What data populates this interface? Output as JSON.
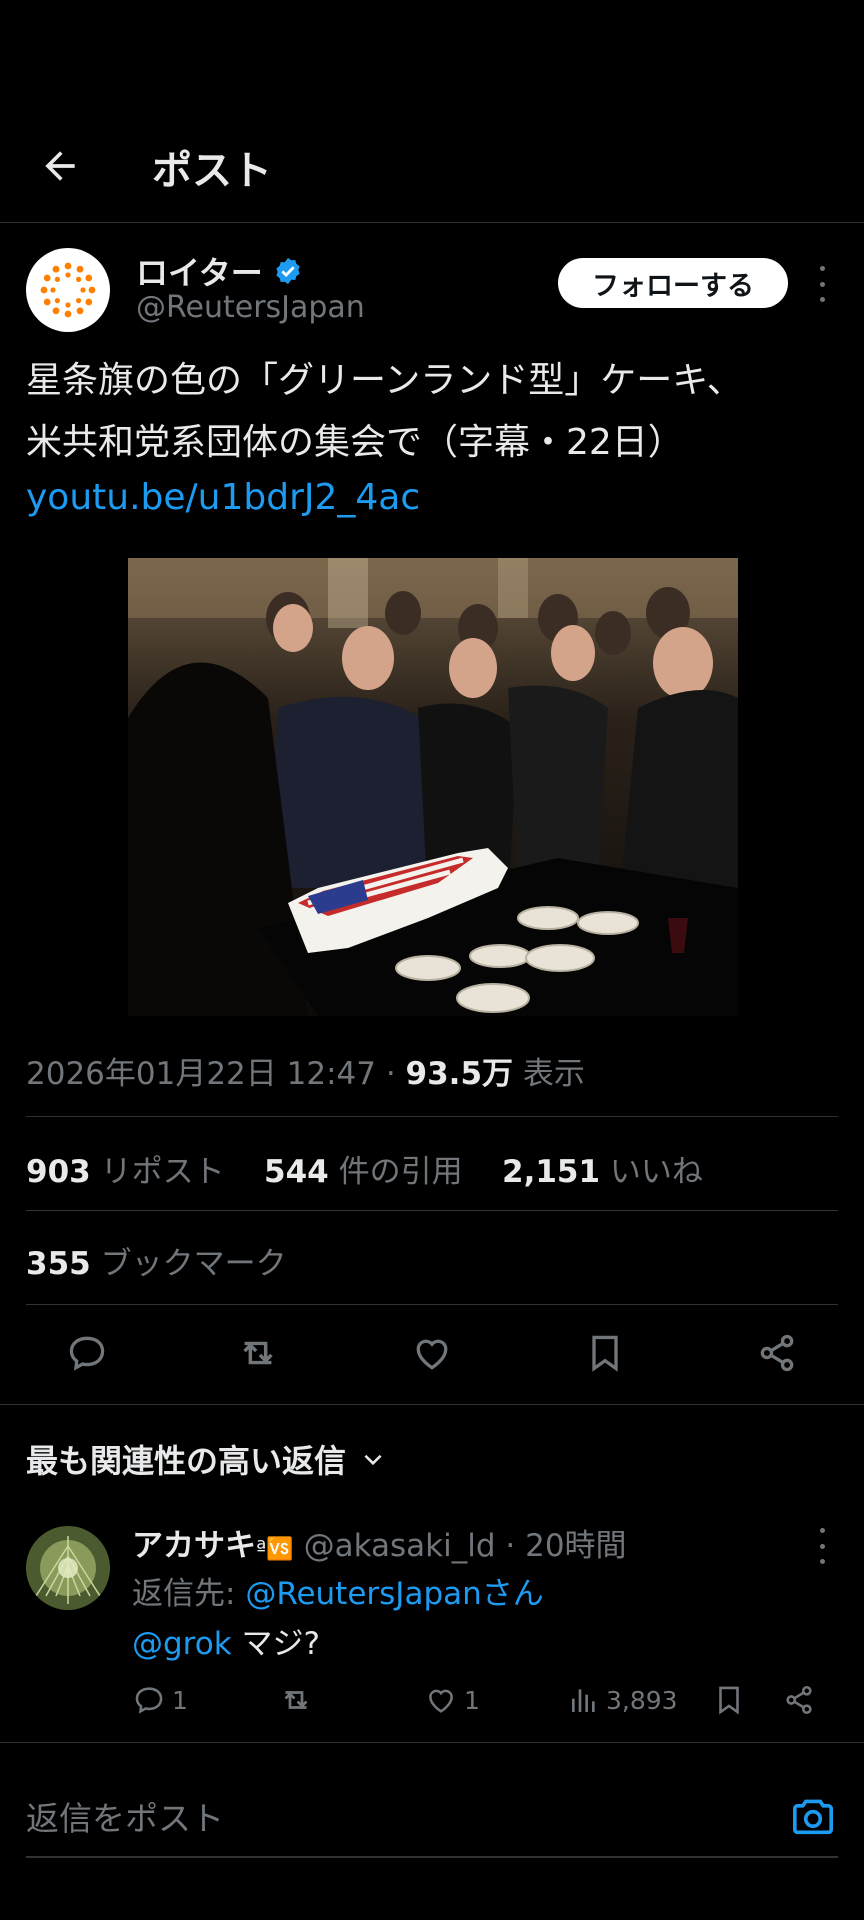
{
  "header": {
    "title": "ポスト"
  },
  "post": {
    "author_name": "ロイター",
    "author_handle": "@ReutersJapan",
    "follow_label": "フォローする",
    "text_line1": "星条旗の色の「グリーンランド型」ケーキ、",
    "text_line2": "米共和党系団体の集会で（字幕・22日）",
    "link": "youtu.be/u1bdrJ2_4ac",
    "timestamp": "2026年01月22日 12:47 ·",
    "views_count": "93.5万",
    "views_label": "表示",
    "reposts_count": "903",
    "reposts_label": "リポスト",
    "quotes_count": "544",
    "quotes_label": "件の引用",
    "likes_count": "2,151",
    "likes_label": "いいね",
    "bookmarks_count": "355",
    "bookmarks_label": "ブックマーク"
  },
  "replies": {
    "sort_label": "最も関連性の高い返信",
    "items": [
      {
        "name": "アカサキ",
        "name_suffix": "ª🆚",
        "handle_time": "@akasaki_ld · 20時間",
        "reply_to_prefix": "返信先: ",
        "reply_to_link": "@ReutersJapanさん",
        "mention": "@grok",
        "text": " マジ?",
        "reply_count": "1",
        "like_count": "1",
        "view_count": "3,893"
      }
    ]
  },
  "composer": {
    "placeholder": "返信をポスト"
  },
  "colors": {
    "accent": "#1d9bf0",
    "background": "#000000",
    "verified": "#1d9bf0",
    "reuters_orange": "#ff8000"
  }
}
